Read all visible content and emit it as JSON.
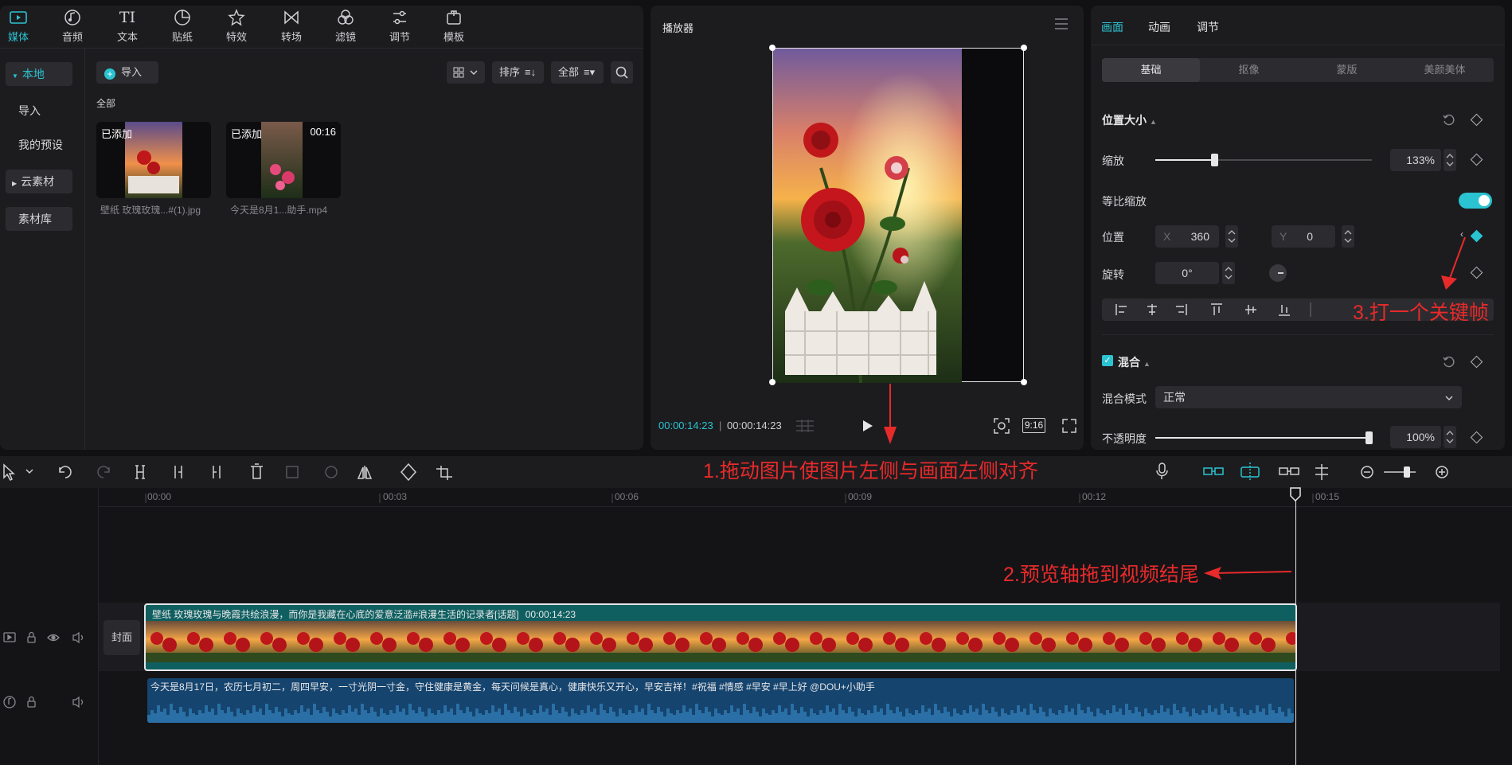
{
  "toolbar_top": {
    "tabs": [
      {
        "label": "媒体",
        "icon": "media-icon"
      },
      {
        "label": "音频",
        "icon": "audio-icon"
      },
      {
        "label": "文本",
        "icon": "text-icon"
      },
      {
        "label": "贴纸",
        "icon": "sticker-icon"
      },
      {
        "label": "特效",
        "icon": "effect-icon"
      },
      {
        "label": "转场",
        "icon": "transition-icon"
      },
      {
        "label": "滤镜",
        "icon": "filter-icon"
      },
      {
        "label": "调节",
        "icon": "adjust-icon"
      },
      {
        "label": "模板",
        "icon": "template-icon"
      }
    ]
  },
  "sidebar": {
    "items": [
      {
        "label": "本地"
      },
      {
        "label": "导入"
      },
      {
        "label": "我的预设"
      },
      {
        "label": "云素材"
      },
      {
        "label": "素材库"
      }
    ]
  },
  "media": {
    "import_label": "导入",
    "sort_label": "排序",
    "filter_label": "全部",
    "section_label": "全部",
    "items": [
      {
        "badge": "已添加",
        "duration": "",
        "name": "壁纸  玫瑰玫瑰...#(1).jpg"
      },
      {
        "badge": "已添加",
        "duration": "00:16",
        "name": "今天是8月1...助手.mp4"
      }
    ]
  },
  "player": {
    "title": "播放器",
    "time_current": "00:00:14:23",
    "time_total": "00:00:14:23",
    "ratio": "9:16"
  },
  "inspector": {
    "tabs": [
      "画面",
      "动画",
      "调节"
    ],
    "subtabs": [
      "基础",
      "抠像",
      "蒙版",
      "美颜美体"
    ],
    "position_size": "位置大小",
    "scale_label": "缩放",
    "scale_value": "133%",
    "scale_level": 0.27,
    "uniform_scale_label": "等比缩放",
    "position_label": "位置",
    "x_label": "X",
    "x_value": "360",
    "y_label": "Y",
    "y_value": "0",
    "rotate_label": "旋转",
    "rotate_value": "0°",
    "blend_section": "混合",
    "blend_mode_label": "混合模式",
    "blend_mode_value": "正常",
    "opacity_label": "不透明度",
    "opacity_value": "100%",
    "opacity_level": 1.0
  },
  "timeline": {
    "ticks": [
      "00:00",
      "00:03",
      "00:06",
      "00:09",
      "00:12",
      "00:15"
    ],
    "cover_label": "封面",
    "video_clip_title": "壁纸  玫瑰玫瑰与晚霞共绘浪漫，而你是我藏在心底的爱意泛滥#浪漫生活的记录者[话题]",
    "video_clip_duration": "00:00:14:23",
    "audio_clip_title": "今天是8月17日，农历七月初二，周四早安，一寸光阴一寸金，守住健康是黄金，每天问候是真心，健康快乐又开心，早安吉祥！#祝福 #情感 #早安 #早上好 @DOU+小助手"
  },
  "annotations": {
    "step1": "1.拖动图片使图片左侧与画面左侧对齐",
    "step2": "2.预览轴拖到视频结尾",
    "step3": "3.打一个关键帧"
  },
  "colors": {
    "accent": "#2bc3d1",
    "annotation": "#e82a2a",
    "video_track": "#0f5f60",
    "audio_track": "#15446e"
  }
}
